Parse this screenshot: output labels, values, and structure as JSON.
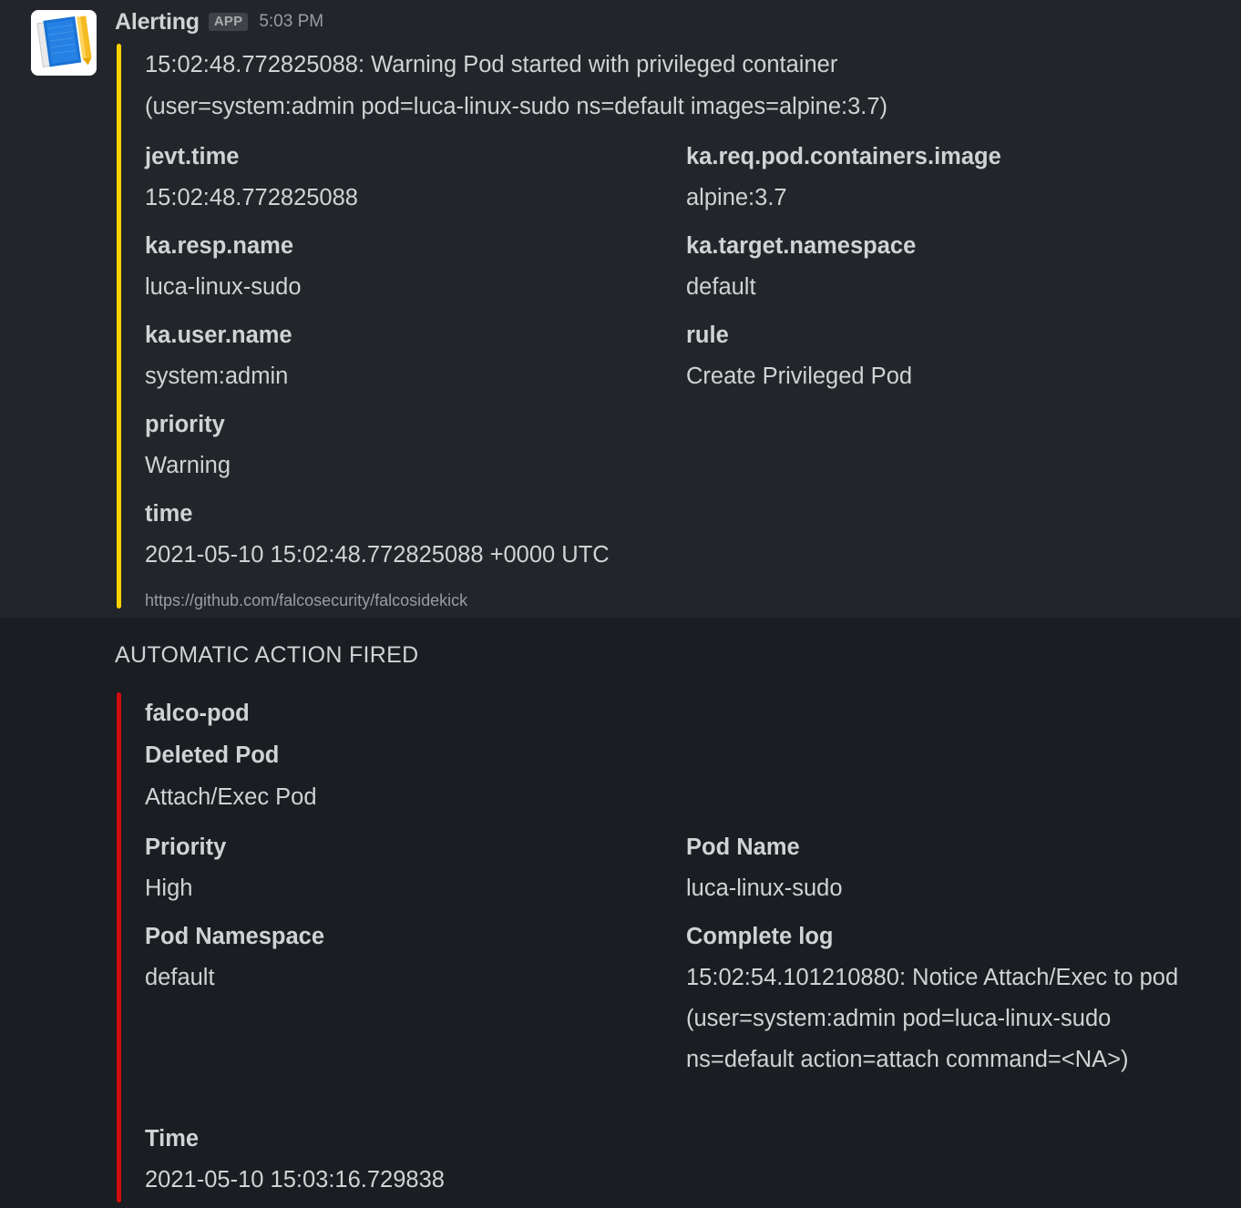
{
  "message": {
    "sender": "Alerting",
    "app_badge": "APP",
    "timestamp": "5:03 PM",
    "avatar_icon": "falco-notebook-icon"
  },
  "alert_attachment": {
    "bar_color": "#ffd204",
    "text_line1": "15:02:48.772825088: Warning Pod started with privileged container",
    "text_line2": "(user=system:admin pod=luca-linux-sudo ns=default images=alpine:3.7)",
    "fields": [
      [
        {
          "label": "jevt.time",
          "value": "15:02:48.772825088"
        },
        {
          "label": "ka.req.pod.containers.image",
          "value": "alpine:3.7"
        }
      ],
      [
        {
          "label": "ka.resp.name",
          "value": "luca-linux-sudo"
        },
        {
          "label": "ka.target.namespace",
          "value": "default"
        }
      ],
      [
        {
          "label": "ka.user.name",
          "value": "system:admin"
        },
        {
          "label": "rule",
          "value": "Create Privileged Pod"
        }
      ],
      [
        {
          "label": "priority",
          "value": "Warning"
        },
        {
          "label": "",
          "value": ""
        }
      ],
      [
        {
          "label": "time",
          "value": "2021-05-10 15:02:48.772825088 +0000 UTC"
        },
        {
          "label": "",
          "value": ""
        }
      ]
    ],
    "footer": "https://github.com/falcosecurity/falcosidekick"
  },
  "action_section": {
    "heading": "AUTOMATIC ACTION FIRED",
    "bar_color": "#d10c0c",
    "title": "falco-pod",
    "subtitle": "Deleted Pod",
    "text": "Attach/Exec Pod",
    "fields": [
      [
        {
          "label": "Priority",
          "value": "High"
        },
        {
          "label": "Pod Name",
          "value": "luca-linux-sudo"
        }
      ],
      [
        {
          "label": "Pod Namespace",
          "value": "default"
        },
        {
          "label": "Complete log",
          "value": "15:02:54.101210880: Notice Attach/Exec to pod (user=system:admin pod=luca-linux-sudo ns=default action=attach command=<NA>)"
        }
      ],
      [
        {
          "label": "Time",
          "value": "2021-05-10 15:03:16.729838"
        },
        {
          "label": "",
          "value": ""
        }
      ]
    ]
  },
  "colors": {
    "message_hover_bg": "#222529",
    "channel_bg": "#1a1d21",
    "text_primary": "#d1d2d3",
    "text_muted": "#9a9da1",
    "warning_bar": "#ffd204",
    "danger_bar": "#d10c0c"
  }
}
